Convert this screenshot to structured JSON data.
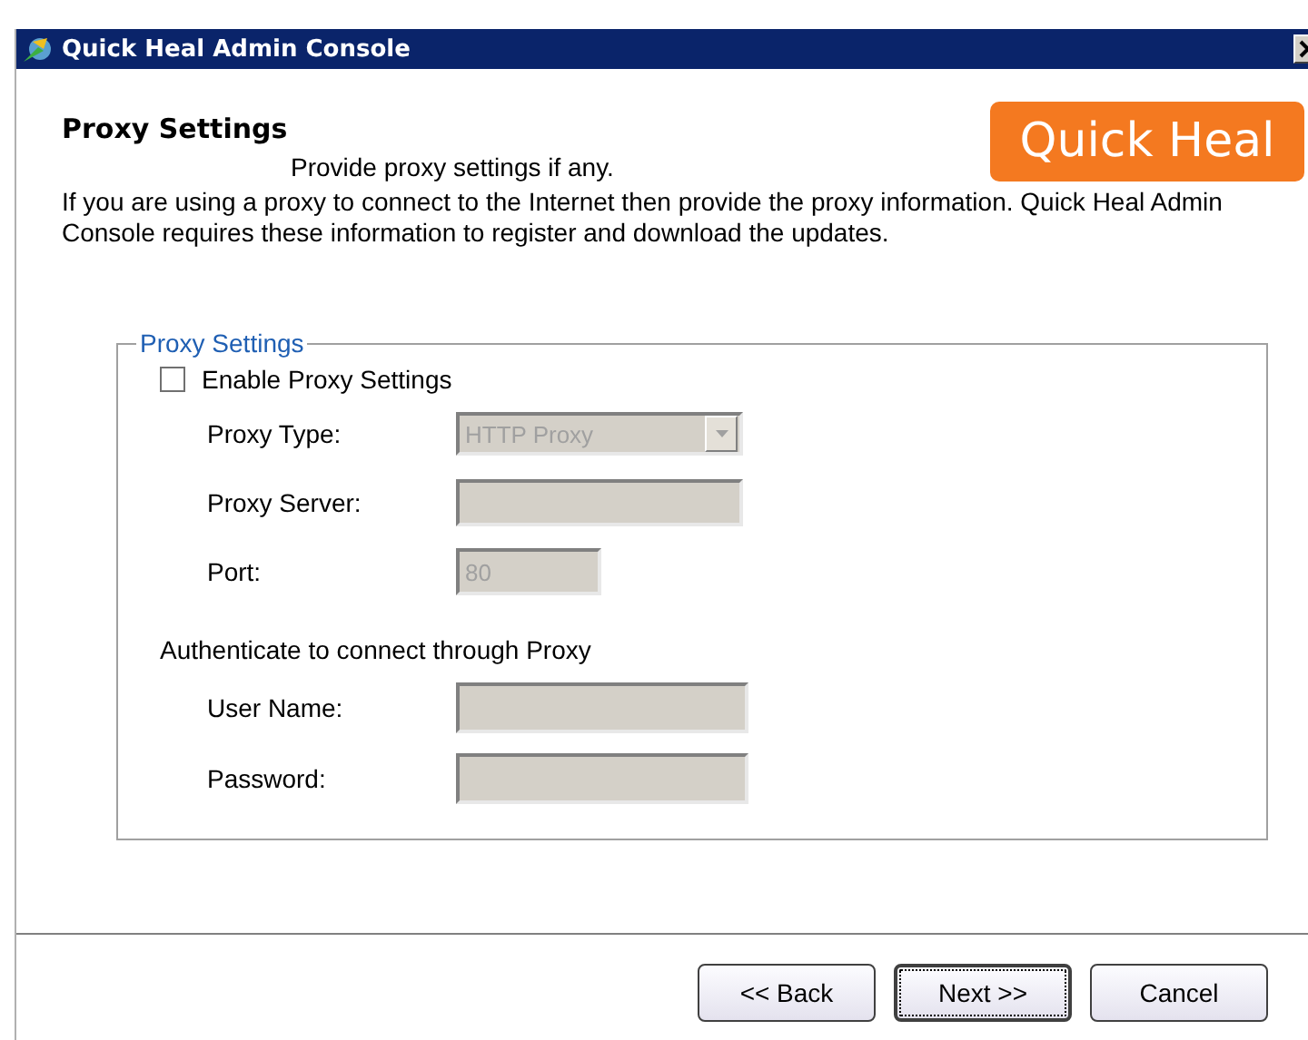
{
  "window": {
    "title": "Quick Heal Admin Console"
  },
  "header": {
    "title": "Proxy Settings",
    "subtitle": "Provide proxy settings if any.",
    "logo": "Quick Heal"
  },
  "description": "If you are using a proxy to connect to the Internet then provide the proxy information. Quick Heal Admin Console requires these information to register and download the updates.",
  "group": {
    "title": "Proxy Settings",
    "enable": {
      "label": "Enable Proxy Settings",
      "checked": false
    },
    "fields": [
      {
        "kind": "dropdown",
        "label": "Proxy Type:",
        "value": "HTTP Proxy",
        "disabled": true
      },
      {
        "kind": "text",
        "label": "Proxy Server:",
        "disabled": true
      },
      {
        "kind": "short",
        "label": "Port:",
        "value": "80",
        "disabled": true
      }
    ],
    "auth_title": "Authenticate to connect through Proxy",
    "auth_fields": [
      {
        "kind": "text",
        "label": "User Name:",
        "disabled": true
      },
      {
        "kind": "text",
        "label": "Password:",
        "disabled": true
      }
    ]
  },
  "buttons": [
    {
      "label": "<< Back",
      "focused": false
    },
    {
      "label": "Next >>",
      "focused": true
    },
    {
      "label": "Cancel",
      "focused": false
    }
  ]
}
